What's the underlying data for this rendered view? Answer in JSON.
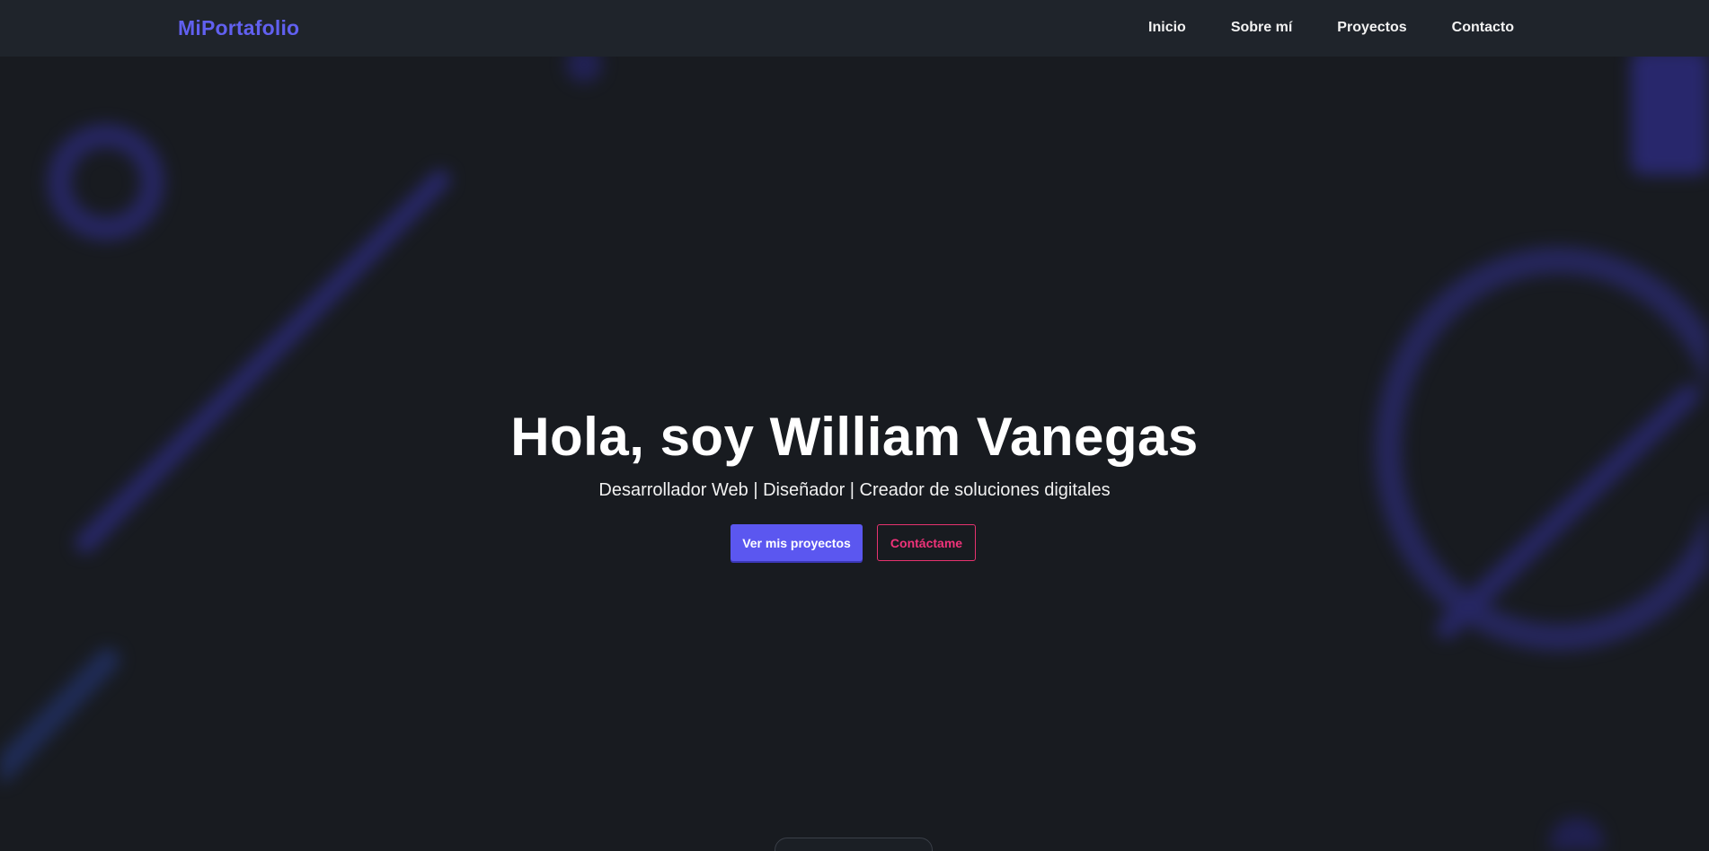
{
  "navbar": {
    "brand": "MiPortafolio",
    "links": [
      "Inicio",
      "Sobre mí",
      "Proyectos",
      "Contacto"
    ]
  },
  "hero": {
    "title": "Hola, soy William Vanegas",
    "subtitle": "Desarrollador Web | Diseñador | Creador de soluciones digitales",
    "primary_button": "Ver mis proyectos",
    "secondary_button": "Contáctame"
  },
  "colors": {
    "background": "#181b20",
    "navbar": "#1f242b",
    "brand": "#6160f0",
    "primary": "#5b57f0",
    "accent": "#f0337a",
    "decoration": "#2e2c86"
  }
}
